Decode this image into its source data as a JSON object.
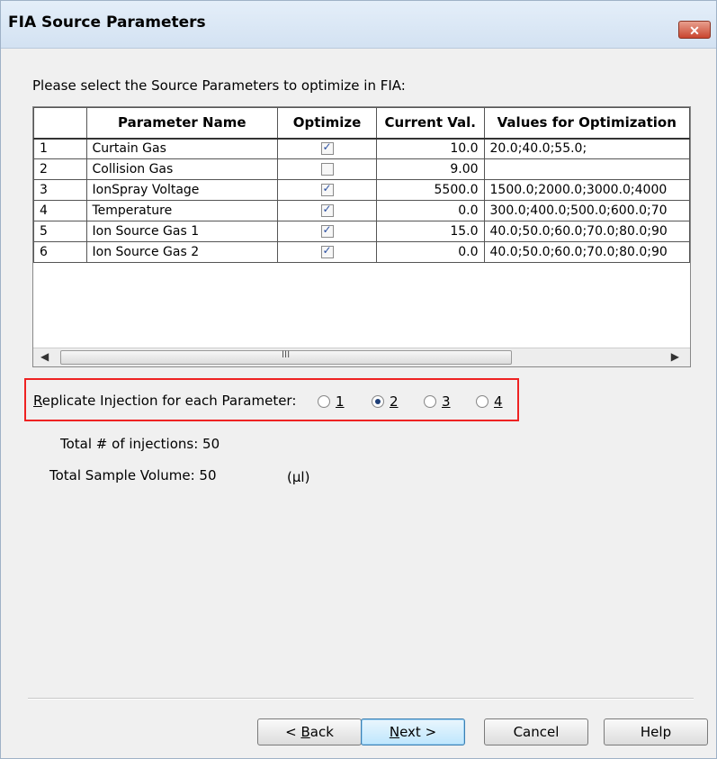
{
  "window": {
    "title": "FIA Source Parameters",
    "close_label": "✕"
  },
  "prompt": "Please select the Source Parameters to optimize in FIA:",
  "grid": {
    "columns": [
      "",
      "Parameter Name",
      "Optimize",
      "Current Val.",
      "Values for Optimization"
    ],
    "rows": [
      {
        "index": "1",
        "name": "Curtain Gas",
        "optimize": true,
        "current": "10.0",
        "values": "20.0;40.0;55.0;"
      },
      {
        "index": "2",
        "name": "Collision Gas",
        "optimize": false,
        "current": "9.00",
        "values": ""
      },
      {
        "index": "3",
        "name": "IonSpray Voltage",
        "optimize": true,
        "current": "5500.0",
        "values": "1500.0;2000.0;3000.0;4000"
      },
      {
        "index": "4",
        "name": "Temperature",
        "optimize": true,
        "current": "0.0",
        "values": "300.0;400.0;500.0;600.0;70"
      },
      {
        "index": "5",
        "name": "Ion Source Gas 1",
        "optimize": true,
        "current": "15.0",
        "values": "40.0;50.0;60.0;70.0;80.0;90"
      },
      {
        "index": "6",
        "name": "Ion Source Gas 2",
        "optimize": true,
        "current": "0.0",
        "values": "40.0;50.0;60.0;70.0;80.0;90"
      }
    ],
    "scroll_grip": "III"
  },
  "replicate": {
    "label_accel": "R",
    "label_rest": "eplicate Injection for each Parameter:",
    "options": [
      "1",
      "2",
      "3",
      "4"
    ],
    "selected": "2"
  },
  "totals": {
    "injections_label": "Total # of injections: 50",
    "volume_label": "Total Sample Volume: 50",
    "volume_unit": "(µl)"
  },
  "buttons": {
    "back_prefix": "< ",
    "back_accel": "B",
    "back_rest": "ack",
    "next_accel": "N",
    "next_rest": "ext >",
    "cancel": "Cancel",
    "help": "Help"
  },
  "colors": {
    "highlight_box": "#e22222",
    "default_button": "#3c7fb1"
  }
}
